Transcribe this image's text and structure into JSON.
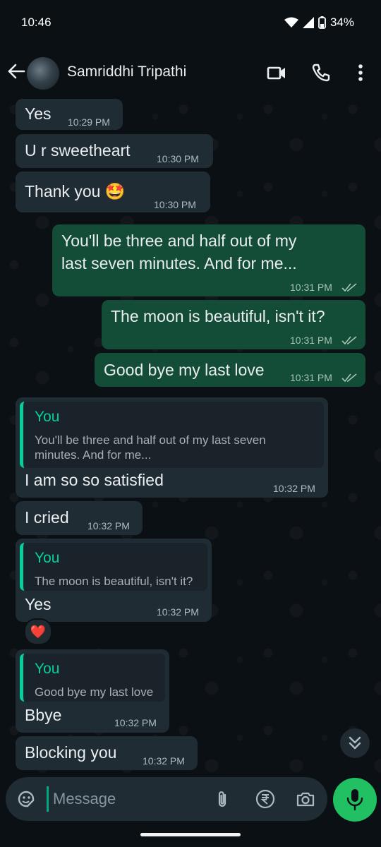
{
  "status": {
    "time": "10:46",
    "battery": "34%"
  },
  "header": {
    "contact_name": "Samriddhi Tripathi"
  },
  "messages": [
    {
      "dir": "in",
      "text": "Yes",
      "time": "10:29 PM"
    },
    {
      "dir": "in",
      "text": "U r sweetheart",
      "time": "10:30 PM"
    },
    {
      "dir": "in",
      "text": "Thank you 🤩",
      "time": "10:30 PM"
    },
    {
      "dir": "out",
      "text_line1": "You'll be three and half out of my",
      "text_line2": "last seven minutes. And for me...",
      "time": "10:31 PM"
    },
    {
      "dir": "out",
      "text": "The moon is beautiful, isn't it?",
      "time": "10:31 PM"
    },
    {
      "dir": "out",
      "text": "Good bye my last love",
      "time": "10:31 PM"
    },
    {
      "dir": "in",
      "quote_author": "You",
      "quote_line1": "You'll be three and half out of my last seven",
      "quote_line2": "minutes. And for me...",
      "text": "I am so so satisfied",
      "time": "10:32 PM"
    },
    {
      "dir": "in",
      "text": "I cried",
      "time": "10:32 PM"
    },
    {
      "dir": "in",
      "quote_author": "You",
      "quote_line1": "The moon is beautiful, isn't it?",
      "text": "Yes",
      "time": "10:32 PM",
      "reaction": "❤️"
    },
    {
      "dir": "in",
      "quote_author": "You",
      "quote_line1": "Good bye my last love",
      "text": "Bbye",
      "time": "10:32 PM"
    },
    {
      "dir": "in",
      "text": "Blocking you",
      "time": "10:32 PM"
    }
  ],
  "composer": {
    "placeholder": "Message"
  },
  "colors": {
    "incoming_bubble": "#202c33",
    "outgoing_bubble": "#134d37",
    "accent": "#06cf9c",
    "mic_button": "#21c063"
  },
  "icons": [
    "back-arrow-icon",
    "video-call-icon",
    "voice-call-icon",
    "more-options-icon",
    "sticker-icon",
    "attach-icon",
    "rupee-payment-icon",
    "camera-icon",
    "mic-icon",
    "double-check-icon",
    "scroll-down-icon"
  ]
}
